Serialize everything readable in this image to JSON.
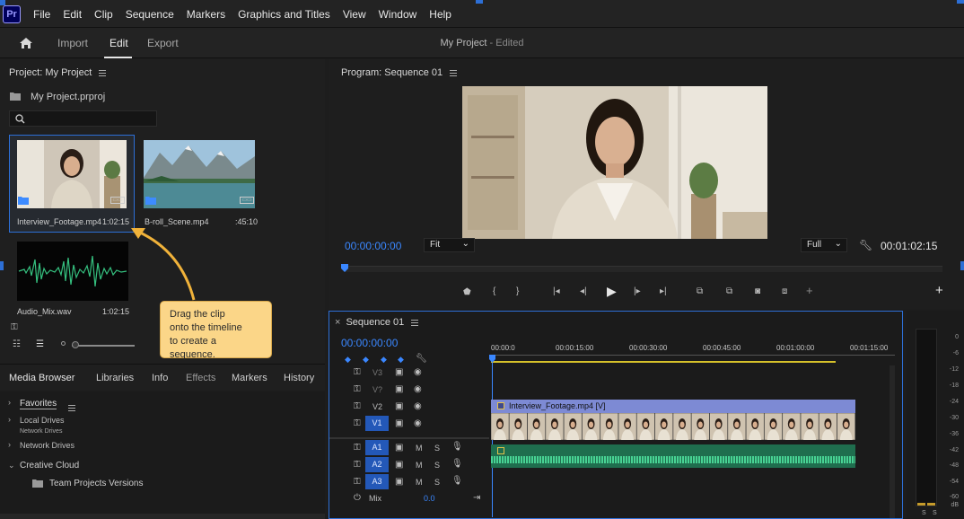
{
  "app": {
    "logo": "Pr",
    "menu": [
      "File",
      "Edit",
      "Clip",
      "Sequence",
      "Markers",
      "Graphics and Titles",
      "View",
      "Window",
      "Help"
    ]
  },
  "workspace": {
    "tabs": [
      "Import",
      "Edit",
      "Export"
    ],
    "active": "Edit",
    "project_title": "My Project",
    "edited_suffix": "- Edited"
  },
  "project": {
    "title": "Project: My Project",
    "file": "My Project.prproj",
    "search_placeholder": "",
    "clips": [
      {
        "name": "Interview_Footage.mp4",
        "duration": "1:02:15"
      },
      {
        "name": "B-roll_Scene.mp4",
        "duration": ":45:10"
      },
      {
        "name": "Audio_Mix.wav",
        "duration": "1:02:15"
      }
    ]
  },
  "tooltip": {
    "line1": "Drag the clip",
    "line2": "onto the timeline",
    "line3": "to create a sequence."
  },
  "lower_tabs": [
    "Media Browser",
    "Libraries",
    "Info",
    "Effects",
    "Markers",
    "History"
  ],
  "media_browser": {
    "items": [
      "Favorites",
      "Local Drives",
      "Network Drives",
      "Creative Cloud",
      "Team Projects Versions"
    ],
    "overlap_text": "Network Drives"
  },
  "program": {
    "title": "Program: Sequence 01",
    "timecode": "00:00:00:00",
    "fit": "Fit",
    "quality": "Full",
    "duration": "00:01:02:15"
  },
  "sequence": {
    "title": "Sequence 01",
    "timecode": "00:00:00:00",
    "ruler": [
      "00:00:0",
      "00:00:15:00",
      "00:00:30:00",
      "00:00:45:00",
      "00:01:00:00",
      "00:01:15:00"
    ],
    "video_tracks": [
      "V3",
      "V2",
      "V1"
    ],
    "src_v": "V1",
    "audio_tracks": [
      "A1",
      "A2",
      "A3"
    ],
    "mix_label": "Mix",
    "mix_value": "0.0",
    "clip_label": "Interview_Footage.mp4 [V]"
  },
  "meter": {
    "labels": [
      "0",
      "-6",
      "-12",
      "-18",
      "-24",
      "-30",
      "-36",
      "-42",
      "-48",
      "-54",
      "-60",
      "dB"
    ],
    "solo": [
      "S",
      "S"
    ]
  },
  "colors": {
    "accent": "#2d6fd6",
    "timecode": "#3a87ff",
    "audio": "#2fb37a",
    "video_clip": "#6f7fd0",
    "tooltip": "#fbd688"
  }
}
